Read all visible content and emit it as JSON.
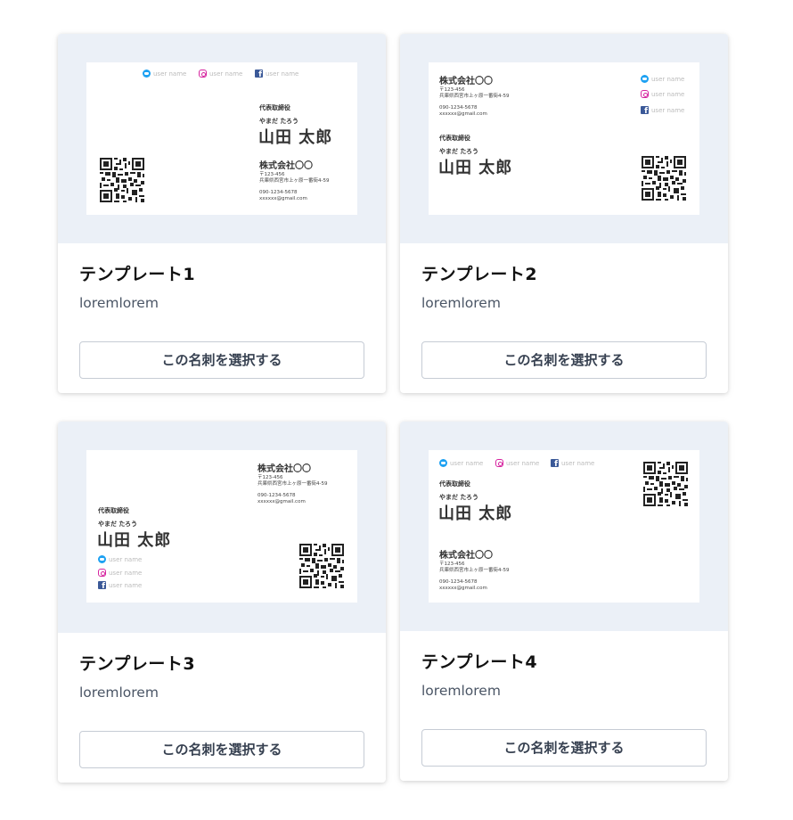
{
  "social_label": "user name",
  "card_info": {
    "role": "代表取締役",
    "kana": "やまだ たろう",
    "name": "山田 太郎",
    "company": "株式会社〇〇",
    "postal": "〒123-456",
    "address": "兵庫県西宮市上ヶ原一番街4-59",
    "phone": "090-1234-5678",
    "email": "xxxxxx@gmail.com"
  },
  "templates": [
    {
      "title": "テンプレート1",
      "description": "loremlorem",
      "button_label": "この名刺を選択する"
    },
    {
      "title": "テンプレート2",
      "description": "loremlorem",
      "button_label": "この名刺を選択する"
    },
    {
      "title": "テンプレート3",
      "description": "loremlorem",
      "button_label": "この名刺を選択する"
    },
    {
      "title": "テンプレート4",
      "description": "loremlorem",
      "button_label": "この名刺を選択する"
    }
  ],
  "colors": {
    "card_header_bg": "#ebf0f7",
    "twitter": "#1da1f2",
    "instagram": "#d6249f",
    "facebook": "#3b5998"
  },
  "icons": [
    "twitter-icon",
    "instagram-icon",
    "facebook-icon",
    "qr-code-icon"
  ]
}
